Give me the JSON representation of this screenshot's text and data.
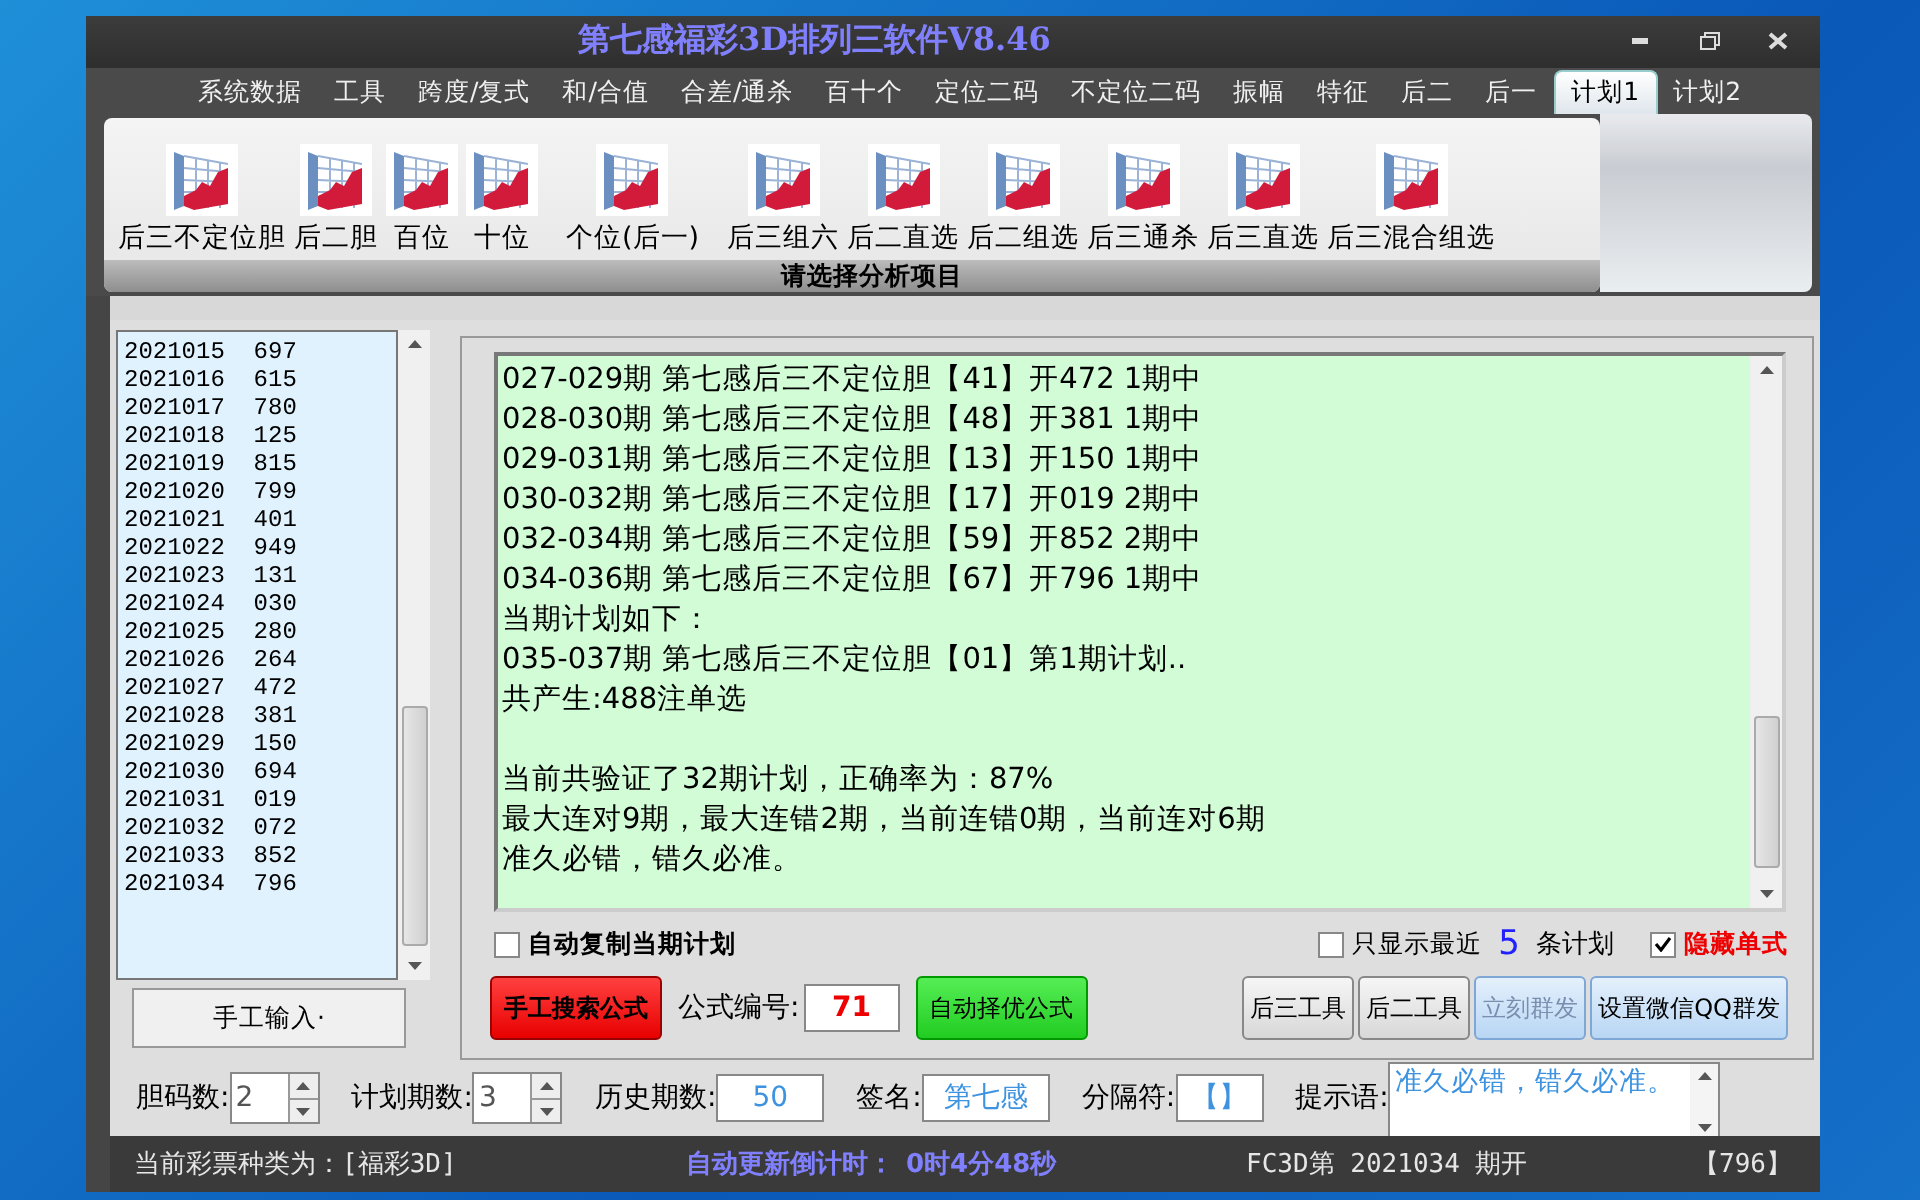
{
  "window": {
    "title": "第七感福彩3D排列三软件V8.46"
  },
  "menu_tabs": [
    {
      "label": "系统数据",
      "selected": false
    },
    {
      "label": "工具",
      "selected": false
    },
    {
      "label": "跨度/复式",
      "selected": false
    },
    {
      "label": "和/合值",
      "selected": false
    },
    {
      "label": "合差/通杀",
      "selected": false
    },
    {
      "label": "百十个",
      "selected": false
    },
    {
      "label": "定位二码",
      "selected": false
    },
    {
      "label": "不定位二码",
      "selected": false
    },
    {
      "label": "振幅",
      "selected": false
    },
    {
      "label": "特征",
      "selected": false
    },
    {
      "label": "后二",
      "selected": false
    },
    {
      "label": "后一",
      "selected": false
    },
    {
      "label": "计划1",
      "selected": true
    },
    {
      "label": "计划2",
      "selected": false
    }
  ],
  "ribbon": {
    "items": [
      "后三不定位胆",
      "后二胆",
      "百位",
      "十位",
      "个位(后一)",
      "后三组六",
      "后二直选",
      "后二组选",
      "后三通杀",
      "后三直选",
      "后三混合组选"
    ],
    "group_label": "请选择分析项目"
  },
  "history_list": {
    "rows": [
      {
        "issue": "2021015",
        "number": "697"
      },
      {
        "issue": "2021016",
        "number": "615"
      },
      {
        "issue": "2021017",
        "number": "780"
      },
      {
        "issue": "2021018",
        "number": "125"
      },
      {
        "issue": "2021019",
        "number": "815"
      },
      {
        "issue": "2021020",
        "number": "799"
      },
      {
        "issue": "2021021",
        "number": "401"
      },
      {
        "issue": "2021022",
        "number": "949"
      },
      {
        "issue": "2021023",
        "number": "131"
      },
      {
        "issue": "2021024",
        "number": "030"
      },
      {
        "issue": "2021025",
        "number": "280"
      },
      {
        "issue": "2021026",
        "number": "264"
      },
      {
        "issue": "2021027",
        "number": "472"
      },
      {
        "issue": "2021028",
        "number": "381"
      },
      {
        "issue": "2021029",
        "number": "150"
      },
      {
        "issue": "2021030",
        "number": "694"
      },
      {
        "issue": "2021031",
        "number": "019"
      },
      {
        "issue": "2021032",
        "number": "072"
      },
      {
        "issue": "2021033",
        "number": "852"
      },
      {
        "issue": "2021034",
        "number": "796"
      }
    ],
    "button": "手工输入·"
  },
  "output": {
    "blocks": [
      [
        "027-029期 第七感后三不定位胆【41】开472 1期中",
        "028-030期 第七感后三不定位胆【48】开381 1期中",
        "029-031期 第七感后三不定位胆【13】开150 1期中",
        "030-032期 第七感后三不定位胆【17】开019 2期中",
        "032-034期 第七感后三不定位胆【59】开852 2期中",
        "034-036期 第七感后三不定位胆【67】开796 1期中",
        "当期计划如下：",
        "035-037期 第七感后三不定位胆【01】第1期计划..",
        "共产生:488注单选"
      ],
      [
        "当前共验证了32期计划，正确率为：87%",
        "最大连对9期，最大连错2期，当前连错0期，当前连对6期",
        "准久必错，错久必准。"
      ]
    ]
  },
  "options": {
    "auto_copy": {
      "label": "自动复制当期计划",
      "checked": false
    },
    "show_recent": {
      "label_before": "只显示最近",
      "count": "5",
      "label_after": "条计划",
      "checked": false
    },
    "hide_single": {
      "label": "隐藏单式",
      "checked": true
    }
  },
  "formula_buttons": [
    {
      "label": "手工搜索公式",
      "kind": "red"
    }
  ],
  "formula_number": {
    "label": "公式编号:",
    "value": "71"
  },
  "formula_buttons_right": [
    {
      "label": "自动择优公式",
      "kind": "green"
    }
  ],
  "tool_buttons": [
    {
      "label": "后三工具",
      "kind": "gray",
      "disabled": false
    },
    {
      "label": "后二工具",
      "kind": "gray",
      "disabled": false
    },
    {
      "label": "立刻群发",
      "kind": "blue",
      "disabled": true
    },
    {
      "label": "设置微信QQ群发",
      "kind": "blue",
      "disabled": false
    }
  ],
  "settings": [
    {
      "kind": "spinner",
      "label": "胆码数:",
      "value": "2"
    },
    {
      "kind": "spinner",
      "label": "计划期数:",
      "value": "3"
    },
    {
      "kind": "field",
      "label": "历史期数:",
      "value": "50"
    },
    {
      "kind": "field",
      "label": "签名:",
      "value": "第七感"
    },
    {
      "kind": "field",
      "label": "分隔符:",
      "value": "【】"
    },
    {
      "kind": "memo",
      "label": "提示语:",
      "value": "准久必错，错久必准。"
    }
  ],
  "status_bar": {
    "lottery": "当前彩票种类为：[福彩3D]",
    "countdown_label": "自动更新倒计时：",
    "countdown": "0时4分48秒",
    "issue": "FC3D第 2021034 期开",
    "result": "【796】"
  }
}
